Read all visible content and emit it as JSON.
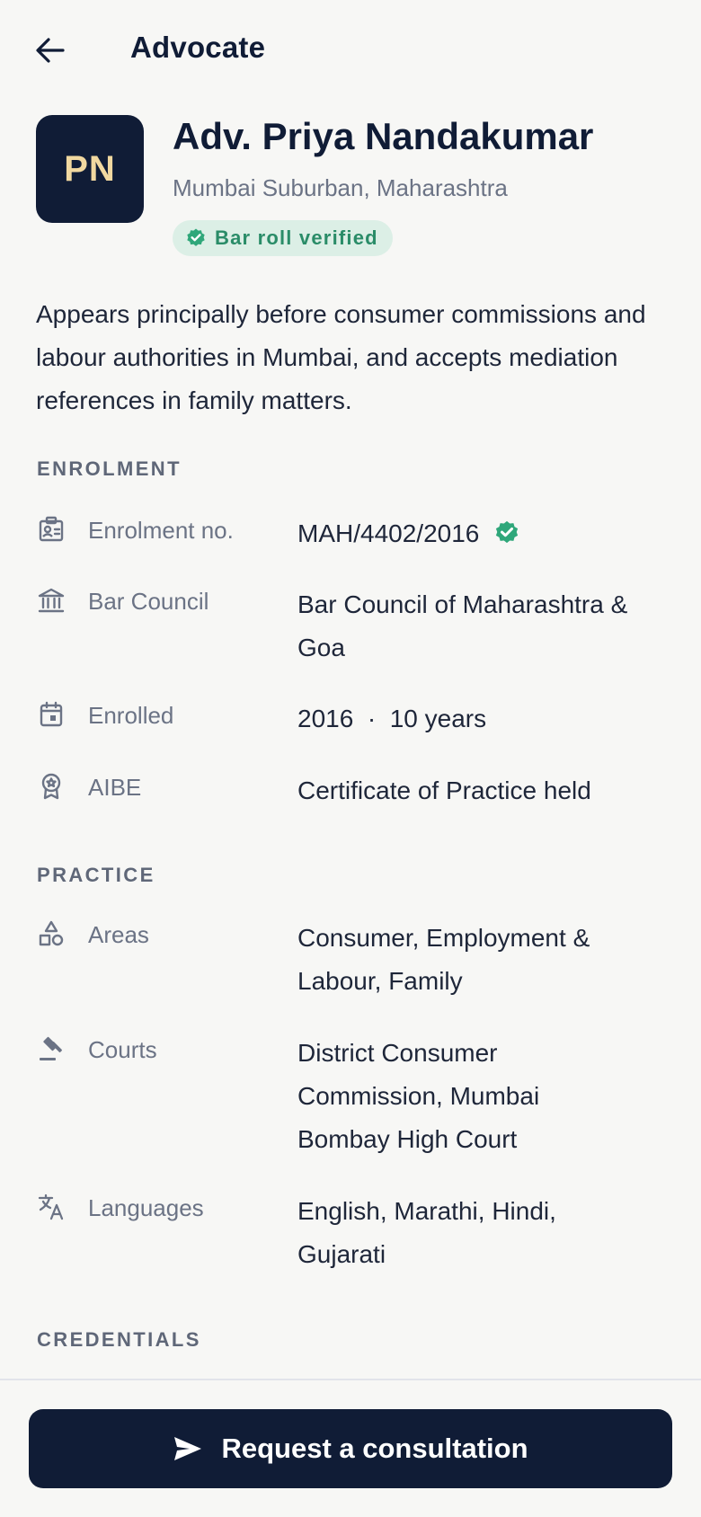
{
  "header": {
    "title": "Advocate",
    "back_icon": "arrow-left-icon"
  },
  "profile": {
    "initials": "PN",
    "name": "Adv. Priya Nandakumar",
    "location": "Mumbai Suburban, Maharashtra",
    "badge": "Bar roll verified"
  },
  "bio": "Appears principally before consumer commissions and labour authorities in Mumbai, and accepts mediation references in family matters.",
  "enrolment": {
    "title": "ENROLMENT",
    "rows": [
      {
        "icon": "id-badge-icon",
        "label": "Enrolment no.",
        "value": "MAH/4402/2016",
        "verified": true
      },
      {
        "icon": "bank-building-icon",
        "label": "Bar Council",
        "value": [
          "Bar Council of Maharashtra &",
          "Goa"
        ]
      },
      {
        "icon": "calendar-icon",
        "label": "Enrolled",
        "value": "2016  ·  10 years"
      },
      {
        "icon": "award-ribbon-icon",
        "label": "AIBE",
        "value": "Certificate of Practice held"
      }
    ]
  },
  "practice": {
    "title": "PRACTICE",
    "rows": [
      {
        "icon": "categories-icon",
        "label": "Areas",
        "value": [
          "Consumer, Employment &",
          "Labour, Family"
        ]
      },
      {
        "icon": "gavel-icon",
        "label": "Courts",
        "value": [
          "District Consumer",
          "Commission, Mumbai",
          "Bombay High Court"
        ]
      },
      {
        "icon": "translate-icon",
        "label": "Languages",
        "value": [
          "English, Marathi, Hindi,",
          "Gujarati"
        ]
      }
    ]
  },
  "credentials": {
    "title": "CREDENTIALS"
  },
  "cta": {
    "label": "Request a consultation",
    "icon": "send-icon"
  },
  "colors": {
    "primary": "#101c36",
    "accent_verified": "#2a8c68",
    "badge_bg": "#dcefe6",
    "initials": "#f1d8a0",
    "background": "#f7f7f5"
  }
}
